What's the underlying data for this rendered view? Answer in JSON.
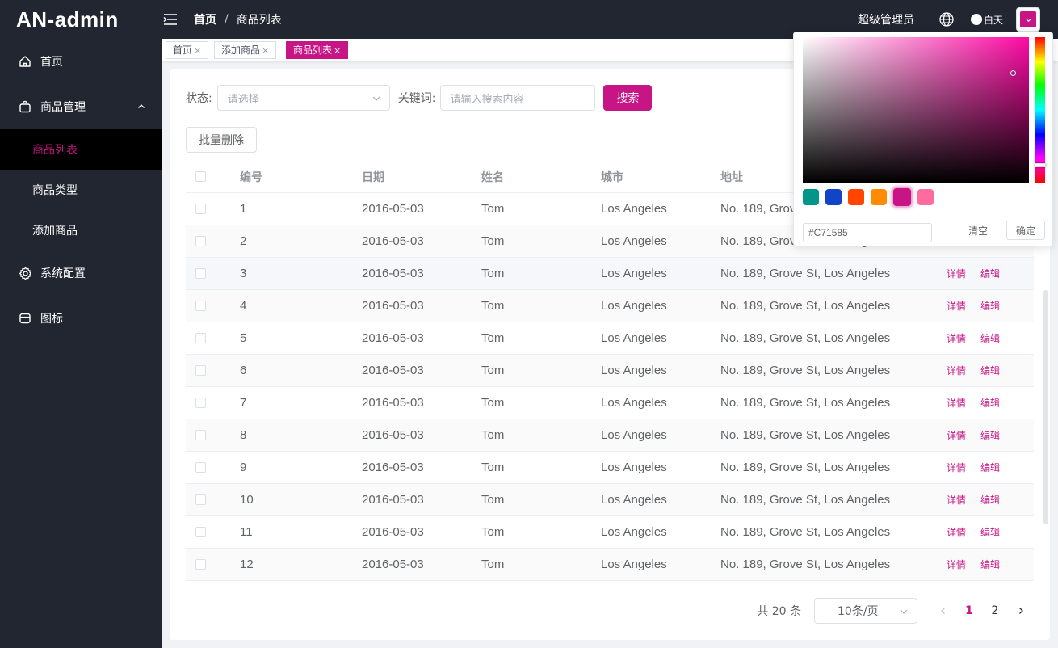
{
  "app": {
    "logo": "AN-admin"
  },
  "sidebar": {
    "items": [
      {
        "label": "首页",
        "icon": "home-icon"
      },
      {
        "label": "商品管理",
        "icon": "shopping-bag-icon",
        "expanded": true,
        "children": [
          {
            "label": "商品列表",
            "active": true
          },
          {
            "label": "商品类型"
          },
          {
            "label": "添加商品"
          }
        ]
      },
      {
        "label": "系统配置",
        "icon": "gear-icon"
      },
      {
        "label": "图标",
        "icon": "folder-icon"
      }
    ]
  },
  "header": {
    "breadcrumb": [
      "首页",
      "商品列表"
    ],
    "breadcrumb_sep": "/",
    "user": "超级管理员",
    "theme_label": "白天",
    "picked_color": "#C71585"
  },
  "tags": [
    {
      "label": "首页",
      "close": "×"
    },
    {
      "label": "添加商品",
      "close": "×"
    },
    {
      "label": "商品列表",
      "close": "×",
      "active": true
    }
  ],
  "filter": {
    "status_label": "状态:",
    "status_placeholder": "请选择",
    "keyword_label": "关键词:",
    "keyword_placeholder": "请输入搜索内容",
    "search_button": "搜索",
    "batch_delete": "批量删除"
  },
  "table": {
    "columns": [
      "编号",
      "日期",
      "姓名",
      "城市",
      "地址"
    ],
    "ops": [
      "详情",
      "编辑"
    ],
    "rows": [
      [
        "1",
        "2016-05-03",
        "Tom",
        "Los Angeles",
        "No. 189, Grove St, Los Angeles"
      ],
      [
        "2",
        "2016-05-03",
        "Tom",
        "Los Angeles",
        "No. 189, Grove St, Los Angeles"
      ],
      [
        "3",
        "2016-05-03",
        "Tom",
        "Los Angeles",
        "No. 189, Grove St, Los Angeles"
      ],
      [
        "4",
        "2016-05-03",
        "Tom",
        "Los Angeles",
        "No. 189, Grove St, Los Angeles"
      ],
      [
        "5",
        "2016-05-03",
        "Tom",
        "Los Angeles",
        "No. 189, Grove St, Los Angeles"
      ],
      [
        "6",
        "2016-05-03",
        "Tom",
        "Los Angeles",
        "No. 189, Grove St, Los Angeles"
      ],
      [
        "7",
        "2016-05-03",
        "Tom",
        "Los Angeles",
        "No. 189, Grove St, Los Angeles"
      ],
      [
        "8",
        "2016-05-03",
        "Tom",
        "Los Angeles",
        "No. 189, Grove St, Los Angeles"
      ],
      [
        "9",
        "2016-05-03",
        "Tom",
        "Los Angeles",
        "No. 189, Grove St, Los Angeles"
      ],
      [
        "10",
        "2016-05-03",
        "Tom",
        "Los Angeles",
        "No. 189, Grove St, Los Angeles"
      ],
      [
        "11",
        "2016-05-03",
        "Tom",
        "Los Angeles",
        "No. 189, Grove St, Los Angeles"
      ],
      [
        "12",
        "2016-05-03",
        "Tom",
        "Los Angeles",
        "No. 189, Grove St, Los Angeles"
      ]
    ]
  },
  "pagination": {
    "total": "共 20 条",
    "page_size": "10条/页",
    "pages": [
      "1",
      "2"
    ],
    "current": "1"
  },
  "color_picker": {
    "hex_value": "#C71585",
    "clear_label": "清空",
    "confirm_label": "确定",
    "presets": [
      "#009688",
      "#1244c8",
      "#ff4500",
      "#ff8c00",
      "#c71585",
      "#ff6b9e"
    ],
    "selected_preset": "#c71585"
  },
  "colors": {
    "accent": "#c71585",
    "sidebar_bg": "#222631"
  }
}
